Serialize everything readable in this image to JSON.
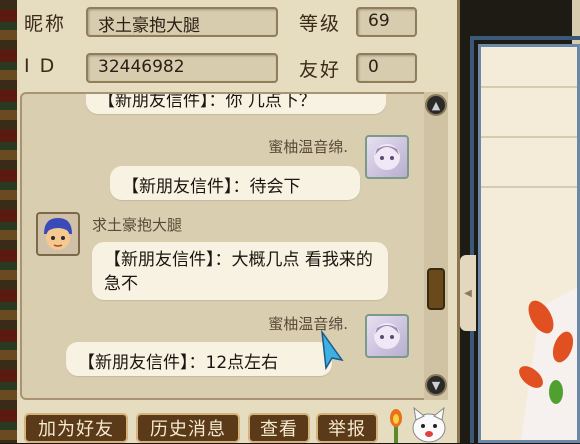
{
  "profile": {
    "nickname_label": "昵称",
    "nickname_value": "求土豪抱大腿",
    "level_label": "等级",
    "level_value": "69",
    "id_label": "I D",
    "id_value": "32446982",
    "friendship_label": "友好",
    "friendship_value": "0"
  },
  "chat": {
    "messages": [
      {
        "sender": "",
        "text": "【新朋友信件】：你 几点下？",
        "side": "partial"
      },
      {
        "sender": "蜜柚温音绵.",
        "text": "【新朋友信件】：待会下",
        "side": "right"
      },
      {
        "sender": "求土豪抱大腿",
        "text": "【新朋友信件】：大概几点 看我来的急不",
        "side": "left"
      },
      {
        "sender": "蜜柚温音绵.",
        "text": "【新朋友信件】：12点左右",
        "side": "right"
      }
    ]
  },
  "scrollbar": {
    "up_icon": "triangle-up-icon",
    "down_icon": "triangle-down-icon"
  },
  "buttons": {
    "add_friend": "加为好友",
    "history": "历史消息",
    "view": "查看",
    "report": "举报"
  },
  "colors": {
    "panel_bg": "#e6dcc0",
    "bubble_bg": "#f7f2e2",
    "button_bg": "#5a3a18",
    "button_border": "#d4b27a"
  }
}
